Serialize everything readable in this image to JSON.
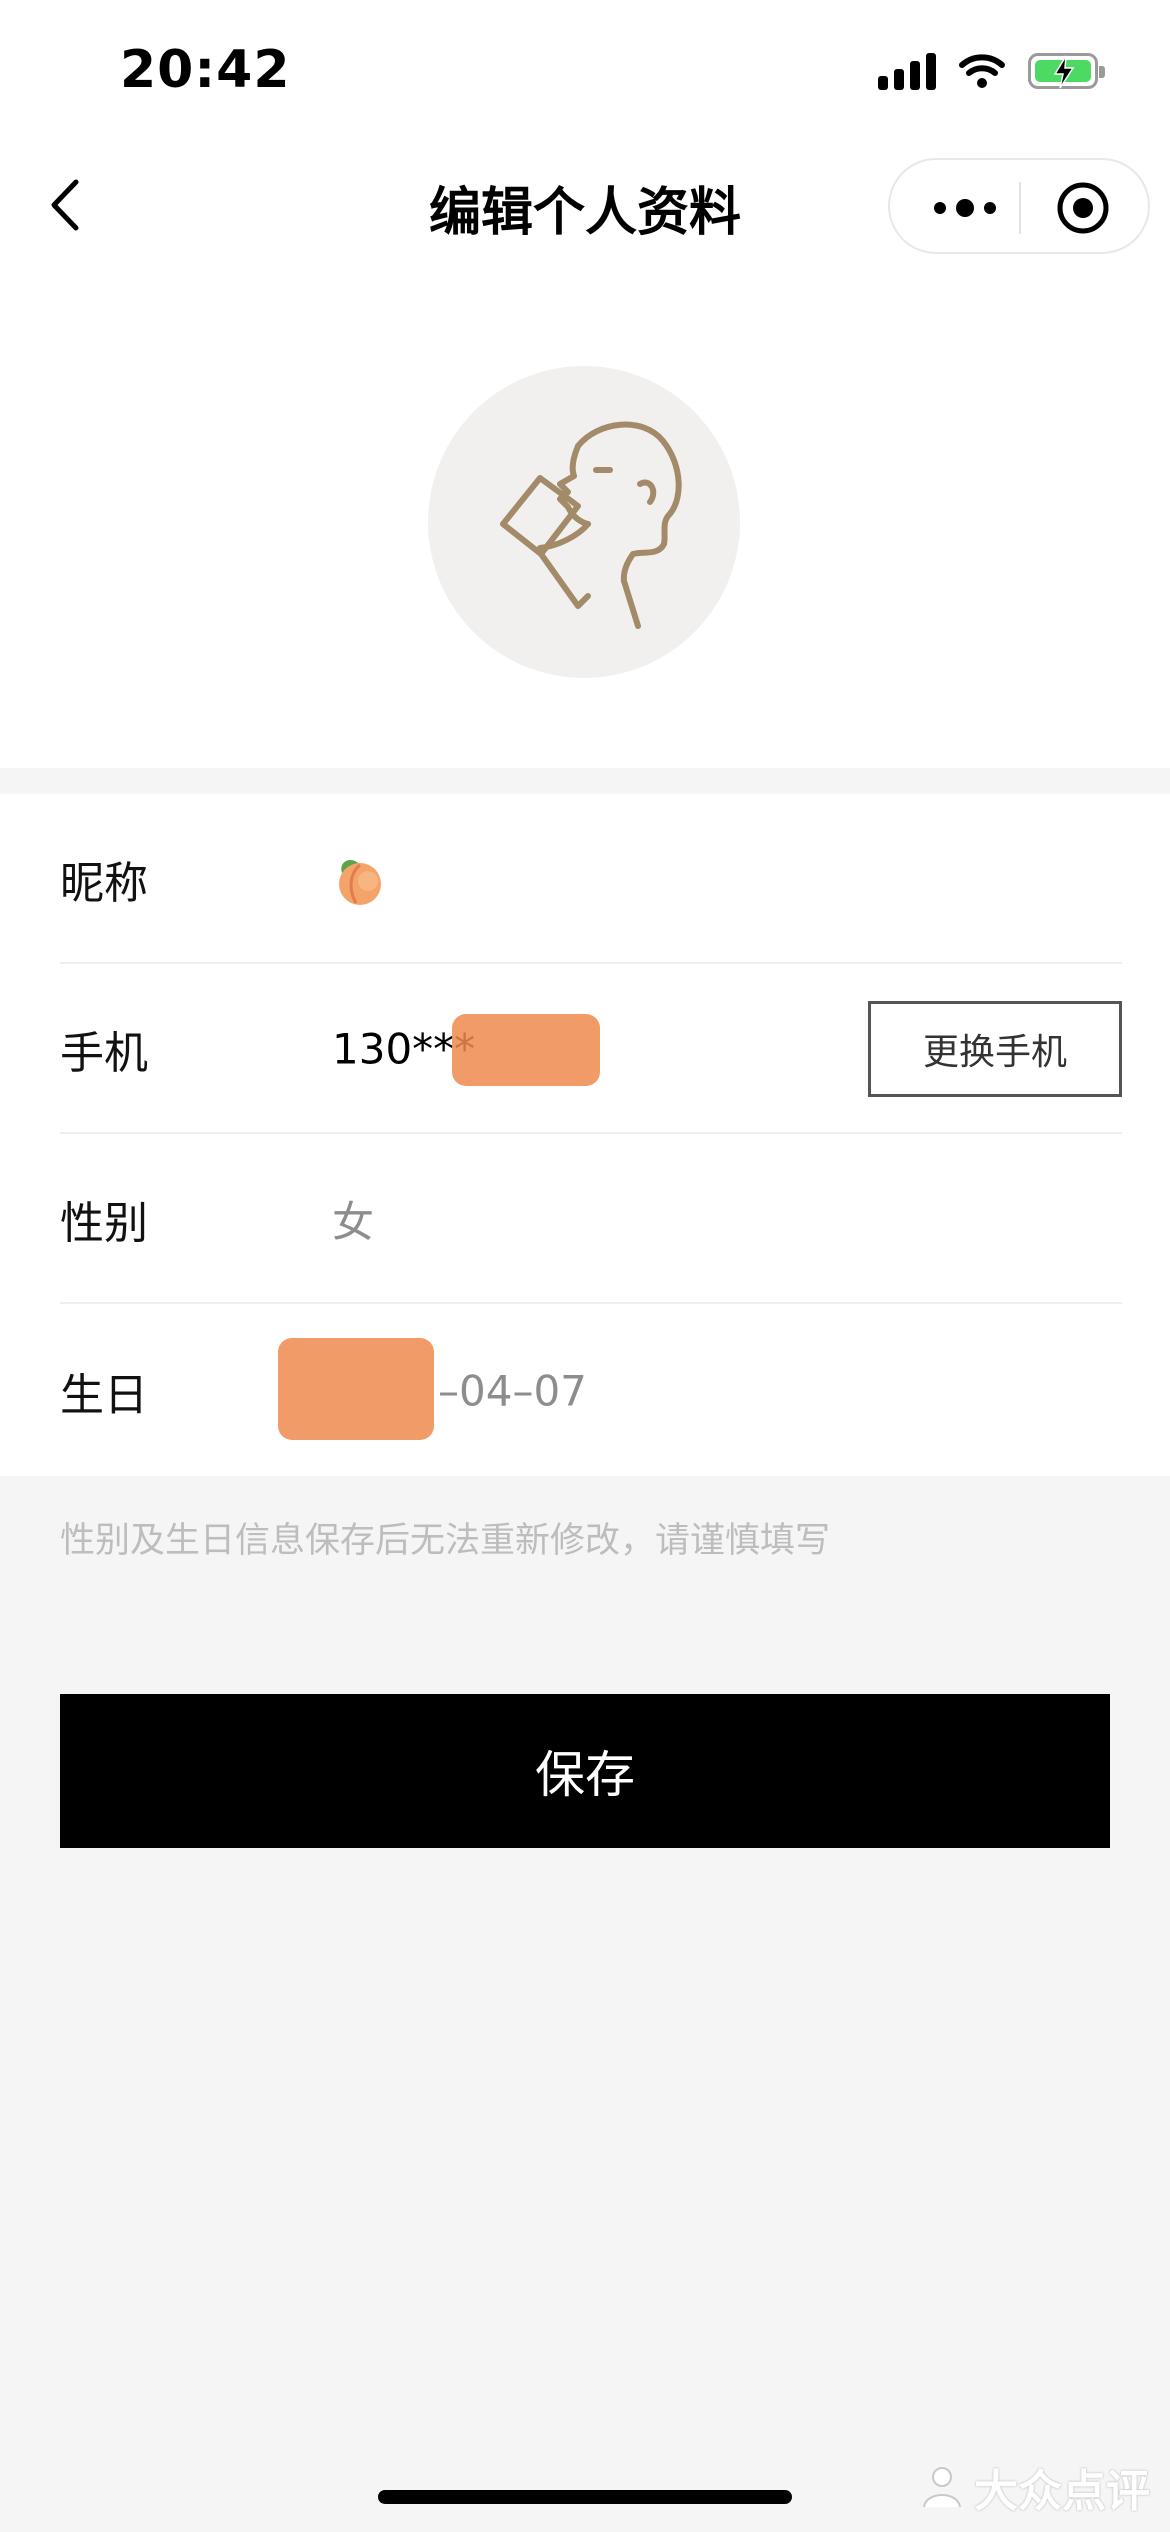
{
  "status_bar": {
    "time": "20:42"
  },
  "nav": {
    "title": "编辑个人资料"
  },
  "form": {
    "nickname": {
      "label": "昵称",
      "value_icon": "peach-emoji"
    },
    "phone": {
      "label": "手机",
      "value": "130***",
      "action_label": "更换手机"
    },
    "gender": {
      "label": "性别",
      "value": "女"
    },
    "birthday": {
      "label": "生日",
      "value": "–04–07"
    }
  },
  "notice": "性别及生日信息保存后无法重新修改，请谨慎填写",
  "save_label": "保存",
  "watermark": "大众点评",
  "colors": {
    "accent": "#a38a68",
    "button_bg": "#000000",
    "background": "#f5f5f5"
  }
}
